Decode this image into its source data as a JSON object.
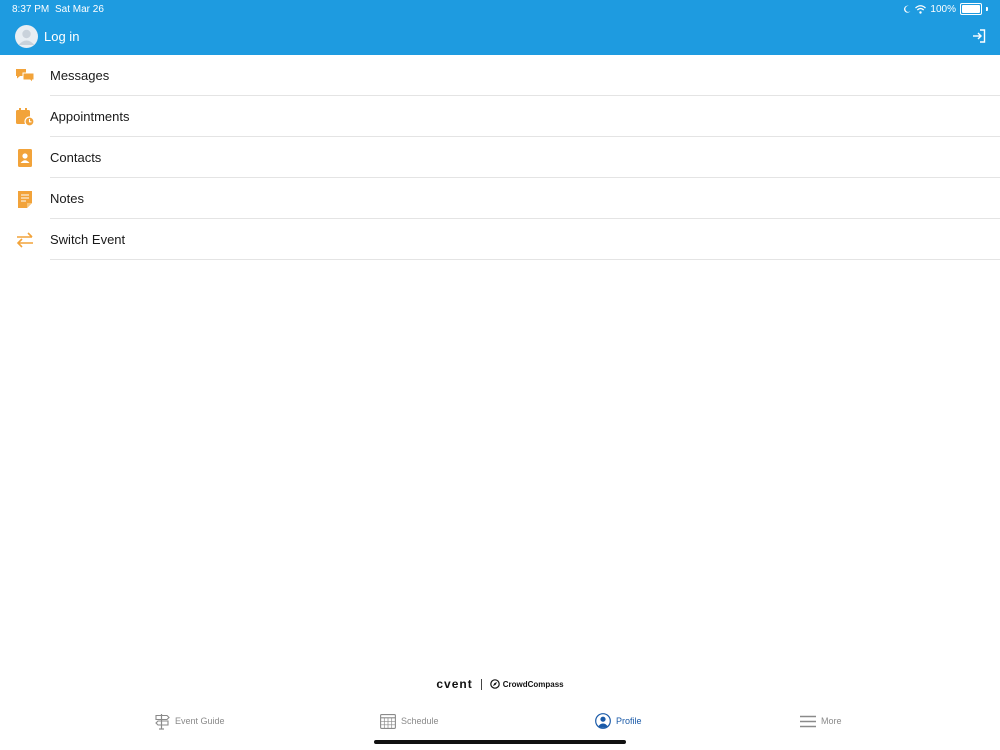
{
  "status_bar": {
    "time": "8:37 PM",
    "date": "Sat Mar 26",
    "battery": "100%"
  },
  "header": {
    "login_label": "Log in",
    "icons": {
      "avatar": "user-avatar",
      "login": "sign-in-icon"
    }
  },
  "menu": {
    "items": [
      {
        "label": "Messages",
        "icon": "chat-bubbles-icon"
      },
      {
        "label": "Appointments",
        "icon": "calendar-clock-icon"
      },
      {
        "label": "Contacts",
        "icon": "contact-book-icon"
      },
      {
        "label": "Notes",
        "icon": "notepad-icon"
      },
      {
        "label": "Switch Event",
        "icon": "swap-arrows-icon"
      }
    ]
  },
  "brand": {
    "cvent": "cvent",
    "crowdcompass": "CrowdCompass"
  },
  "tabs": [
    {
      "label": "Event Guide",
      "icon": "signpost-icon",
      "active": false
    },
    {
      "label": "Schedule",
      "icon": "calendar-grid-icon",
      "active": false
    },
    {
      "label": "Profile",
      "icon": "profile-icon",
      "active": true
    },
    {
      "label": "More",
      "icon": "hamburger-icon",
      "active": false
    }
  ],
  "colors": {
    "header": "#1e9be0",
    "accent_icon": "#f2a33a",
    "active_tab": "#1a5aa8"
  }
}
